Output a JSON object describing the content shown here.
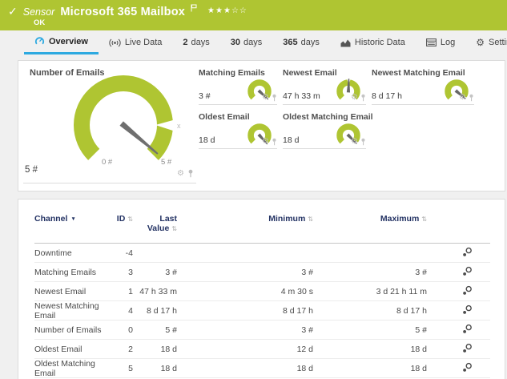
{
  "colors": {
    "status_green": "#afc532",
    "accent_blue": "#2da9e0",
    "table_header_navy": "#233263"
  },
  "header": {
    "type_label": "Sensor",
    "title": "Microsoft 365 Mailbox",
    "status": "OK",
    "stars_filled": "★★★",
    "stars_empty": "☆☆"
  },
  "tabs": [
    {
      "label": "Overview"
    },
    {
      "label": "Live Data"
    },
    {
      "num": "2",
      "unit": "days"
    },
    {
      "num": "30",
      "unit": "days"
    },
    {
      "num": "365",
      "unit": "days"
    },
    {
      "label": "Historic Data"
    },
    {
      "label": "Log"
    },
    {
      "label": "Settings"
    }
  ],
  "gauges": {
    "main": {
      "title": "Number of Emails",
      "value": "5 #",
      "scale_min": "0 #",
      "scale_max": "5 #"
    },
    "cells": [
      {
        "title": "Matching Emails",
        "value": "3 #"
      },
      {
        "title": "Newest Email",
        "value": "47 h 33 m"
      },
      {
        "title": "Newest Matching Email",
        "value": "8 d 17 h"
      },
      {
        "title": "Oldest Email",
        "value": "18 d"
      },
      {
        "title": "Oldest Matching Email",
        "value": "18 d"
      }
    ]
  },
  "table": {
    "headers": {
      "channel": "Channel",
      "id": "ID",
      "last": "Last Value",
      "min": "Minimum",
      "max": "Maximum"
    },
    "rows": [
      {
        "channel": "Downtime",
        "id": "-4",
        "last": "",
        "min": "",
        "max": ""
      },
      {
        "channel": "Matching Emails",
        "id": "3",
        "last": "3 #",
        "min": "3 #",
        "max": "3 #"
      },
      {
        "channel": "Newest Email",
        "id": "1",
        "last": "47 h 33 m",
        "min": "4 m 30 s",
        "max": "3 d 21 h 11 m"
      },
      {
        "channel": "Newest Matching Email",
        "id": "4",
        "last": "8 d 17 h",
        "min": "8 d 17 h",
        "max": "8 d 17 h"
      },
      {
        "channel": "Number of Emails",
        "id": "0",
        "last": "5 #",
        "min": "3 #",
        "max": "5 #"
      },
      {
        "channel": "Oldest Email",
        "id": "2",
        "last": "18 d",
        "min": "12 d",
        "max": "18 d"
      },
      {
        "channel": "Oldest Matching Email",
        "id": "5",
        "last": "18 d",
        "min": "18 d",
        "max": "18 d"
      }
    ]
  }
}
